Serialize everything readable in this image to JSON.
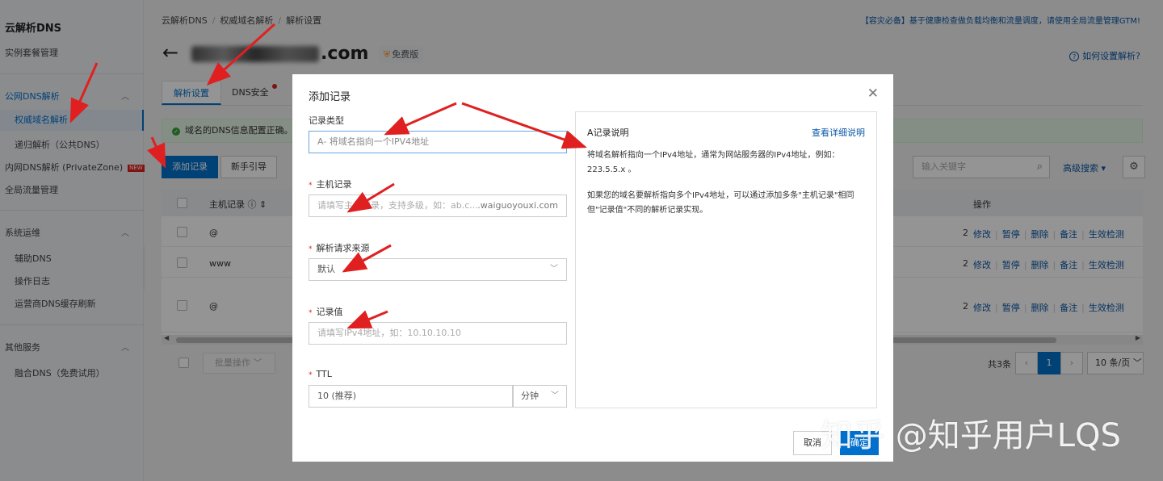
{
  "sidebar": {
    "title": "云解析DNS",
    "instance_pkg": "实例套餐管理",
    "group_public": "公网DNS解析",
    "item_authoritative": "权威域名解析",
    "item_recursive": "递归解析（公共DNS）",
    "item_private": "内网DNS解析 (PrivateZone)",
    "new_badge": "NEW",
    "item_gtm": "全局流量管理",
    "group_ops": "系统运维",
    "item_assist": "辅助DNS",
    "item_logs": "操作日志",
    "item_cache": "运营商DNS缓存刷新",
    "group_other": "其他服务",
    "item_fusion": "融合DNS（免费试用）"
  },
  "header": {
    "breadcrumb": [
      "云解析DNS",
      "权威域名解析",
      "解析设置"
    ],
    "notice": "【容灾必备】基于健康检查做负载均衡和流量调度，请使用全局流量管理GTM!",
    "domain_visible": ".com",
    "free_badge": "免费版",
    "help_link": "如何设置解析?"
  },
  "tabs": [
    {
      "label": "解析设置"
    },
    {
      "label": "DNS安全"
    }
  ],
  "success_msg": "域名的DNS信息配置正确。",
  "toolbar": {
    "add_record": "添加记录",
    "guide": "新手引导",
    "search_placeholder": "输入关键字",
    "advanced_search": "高级搜索"
  },
  "table": {
    "col_host": "主机记录",
    "col_ops": "操作",
    "rows": [
      {
        "host": "@",
        "count": "2"
      },
      {
        "host": "www",
        "count": "2"
      },
      {
        "host": "@",
        "count": "2"
      }
    ],
    "ops": [
      "修改",
      "暂停",
      "删除",
      "备注",
      "生效检测"
    ]
  },
  "footer": {
    "batch": "批量操作",
    "total": "共3条",
    "page": "1",
    "page_size": "10 条/页"
  },
  "modal": {
    "title": "添加记录",
    "type_label": "记录类型",
    "type_value": "A- 将域名指向一个IPV4地址",
    "host_label": "主机记录",
    "host_placeholder": "请填写主机记录，支持多级，如：ab.c...",
    "host_suffix": ".waiguoyouxi.com",
    "source_label": "解析请求来源",
    "source_value": "默认",
    "value_label": "记录值",
    "value_placeholder": "请填写IPv4地址，如：10.10.10.10",
    "ttl_label": "TTL",
    "ttl_value": "10 (推荐)",
    "ttl_unit": "分钟",
    "cancel": "取消",
    "confirm": "确定",
    "info_title": "A记录说明",
    "info_link": "查看详细说明",
    "info_p1": "将域名解析指向一个IPv4地址，通常为网站服务器的IPv4地址，例如：223.5.5.x 。",
    "info_p2": "如果您的域名要解析指向多个IPv4地址，可以通过添加多条\"主机记录\"相同但\"记录值\"不同的解析记录实现。"
  },
  "watermark": "知乎 @知乎用户LQS",
  "colors": {
    "accent": "#0070cc",
    "annotation_arrow": "#e02020",
    "success": "#3aa13a"
  }
}
